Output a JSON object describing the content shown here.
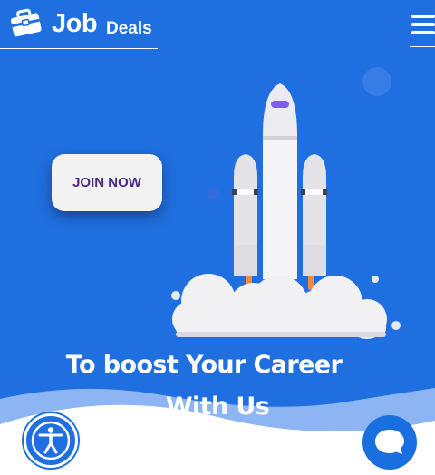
{
  "brand": {
    "name_primary": "Job",
    "name_secondary": "Deals",
    "logo_icon": "briefcase-icon"
  },
  "header": {
    "menu_icon": "hamburger-menu-icon"
  },
  "hero": {
    "cta_label": "JOIN NOW",
    "headline_line1": "To boost Your Career",
    "headline_line2": "With Us",
    "illustration": "rocket-launch-illustration"
  },
  "widgets": {
    "accessibility_icon": "accessibility-icon",
    "chat_icon": "chat-bubble-icon"
  },
  "colors": {
    "background": "#1f6fe0",
    "cta_text": "#4a2a85",
    "white": "#ffffff"
  }
}
